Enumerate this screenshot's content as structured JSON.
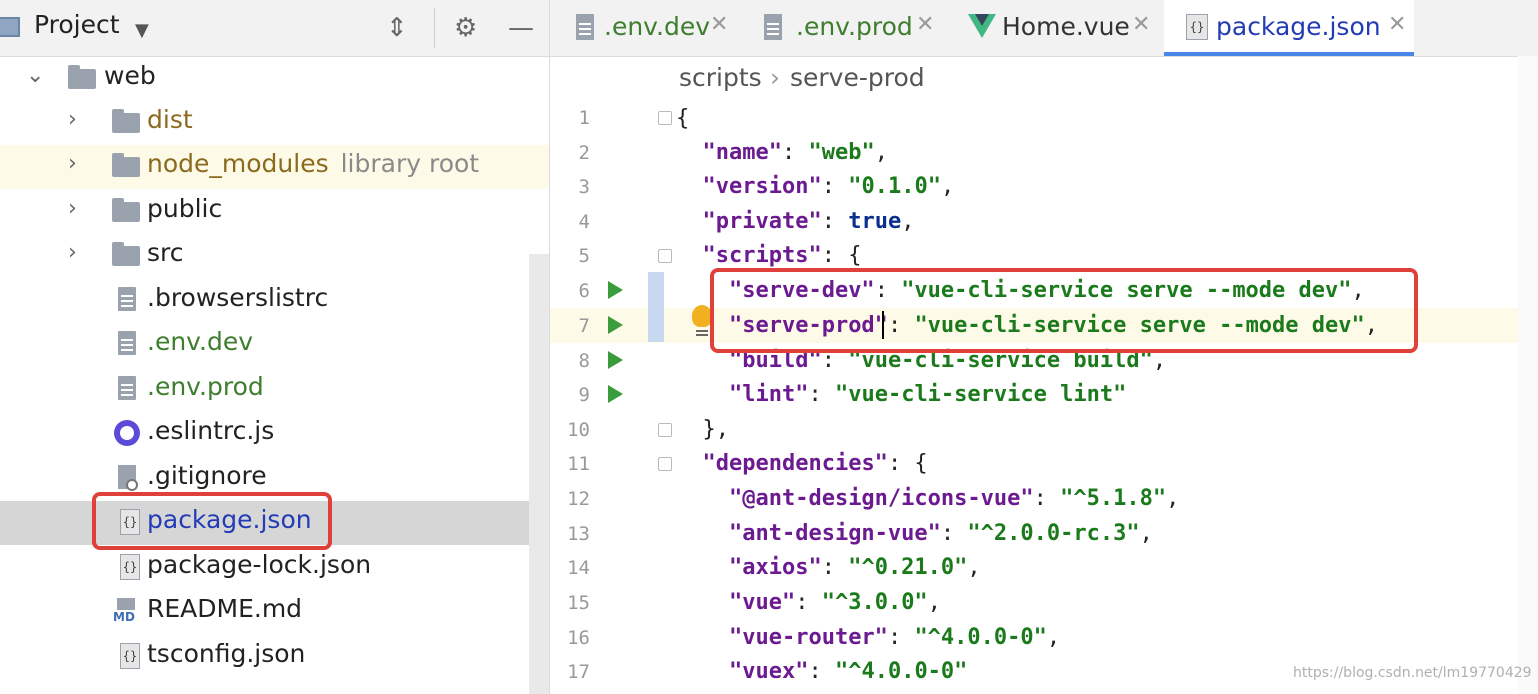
{
  "project_panel": {
    "title": "Project",
    "tree": [
      {
        "label": "web"
      },
      {
        "label": "dist"
      },
      {
        "label": "node_modules",
        "sub": "library root"
      },
      {
        "label": "public"
      },
      {
        "label": "src"
      },
      {
        "label": ".browserslistrc"
      },
      {
        "label": ".env.dev"
      },
      {
        "label": ".env.prod"
      },
      {
        "label": ".eslintrc.js"
      },
      {
        "label": ".gitignore"
      },
      {
        "label": "package.json"
      },
      {
        "label": "package-lock.json"
      },
      {
        "label": "README.md"
      },
      {
        "label": "tsconfig.json"
      }
    ]
  },
  "editor": {
    "tabs": [
      {
        "label": ".env.dev"
      },
      {
        "label": ".env.prod"
      },
      {
        "label": "Home.vue"
      },
      {
        "label": "package.json"
      }
    ],
    "active_tab": "package.json",
    "breadcrumb": [
      "scripts",
      "serve-prod"
    ],
    "line_numbers": [
      "1",
      "2",
      "3",
      "4",
      "5",
      "6",
      "7",
      "8",
      "9",
      "10",
      "11",
      "12",
      "13",
      "14",
      "15",
      "16",
      "17"
    ],
    "code": {
      "l1": "{",
      "l2k": "\"name\"",
      "l2s": "\"web\"",
      "l3k": "\"version\"",
      "l3s": "\"0.1.0\"",
      "l4k": "\"private\"",
      "l4v": "true",
      "l5k": "\"scripts\"",
      "l6k": "\"serve-dev\"",
      "l6s": "\"vue-cli-service serve --mode dev\"",
      "l7k": "\"serve-prod\"",
      "l7s": "\"vue-cli-service serve --mode dev\"",
      "l8k": "\"build\"",
      "l8s": "\"vue-cli-service build\"",
      "l9k": "\"lint\"",
      "l9s": "\"vue-cli-service lint\"",
      "l10": "},",
      "l11k": "\"dependencies\"",
      "l12k": "\"@ant-design/icons-vue\"",
      "l12s": "\"^5.1.8\"",
      "l13k": "\"ant-design-vue\"",
      "l13s": "\"^2.0.0-rc.3\"",
      "l14k": "\"axios\"",
      "l14s": "\"^0.21.0\"",
      "l15k": "\"vue\"",
      "l15s": "\"^3.0.0\"",
      "l16k": "\"vue-router\"",
      "l16s": "\"^4.0.0-0\"",
      "l17k": "\"vuex\"",
      "l17s": "\"^4.0.0-0\""
    }
  },
  "watermark": "https://blog.csdn.net/lm19770429",
  "colors": {
    "highlight_box": "#e0403a",
    "active_tab": "#4a86e8"
  }
}
